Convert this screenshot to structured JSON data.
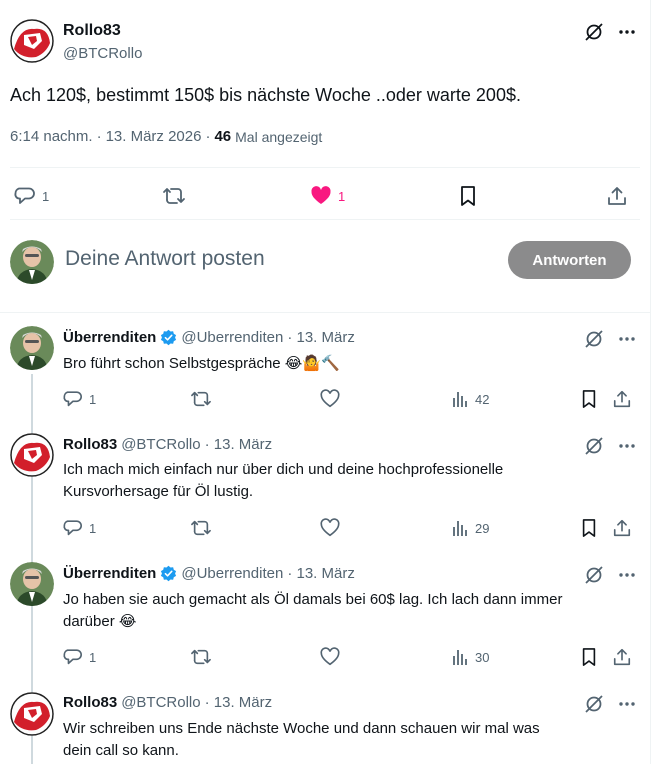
{
  "main_tweet": {
    "name": "Rollo83",
    "handle": "@BTCRollo",
    "text": "Ach 120$, bestimmt 150$ bis nächste Woche ..oder warte 200$.",
    "time": "6:14 nachm.",
    "date": "13. März 2026",
    "views": "46",
    "views_label": "Mal angezeigt",
    "replies": "1",
    "likes": "1"
  },
  "reply_composer": {
    "placeholder": "Deine Antwort posten",
    "button": "Antworten"
  },
  "replies": [
    {
      "name": "Überrenditen",
      "verified": true,
      "handle": "@Uberrenditen",
      "date": "· 13. März",
      "text": "Bro führt schon Selbstgespräche 😂🤷🔨",
      "replies": "1",
      "views": "42"
    },
    {
      "name": "Rollo83",
      "verified": false,
      "handle": "@BTCRollo",
      "date": "· 13. März",
      "text_line1": "Ich mach mich einfach nur über dich und deine hochprofessionelle",
      "text_line2": "Kursvorhersage für Öl lustig.",
      "replies": "1",
      "views": "29"
    },
    {
      "name": "Überrenditen",
      "verified": true,
      "handle": "@Uberrenditen",
      "date": "· 13. März",
      "text_line1": "Jo haben sie auch gemacht als Öl damals bei 60$ lag. Ich lach dann immer",
      "text_line2": "darüber 😂",
      "replies": "1",
      "views": "30"
    },
    {
      "name": "Rollo83",
      "verified": false,
      "handle": "@BTCRollo",
      "date": "· 13. März",
      "text_line1": "Wir schreiben uns Ende nächste Woche und dann schauen wir mal was",
      "text_line2": "dein call so kann."
    }
  ],
  "colors": {
    "like_pink": "#f91880",
    "verified_blue": "#1d9bf0",
    "secondary_text": "#536471",
    "button_gray": "#8b8b8c"
  }
}
